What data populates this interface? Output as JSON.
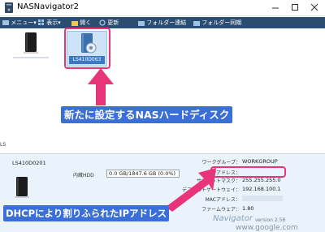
{
  "window": {
    "title": "NASNavigator2"
  },
  "toolbar": {
    "menu": "メニュー",
    "view": "表示",
    "open": "開く",
    "refresh": "更新",
    "folder_link": "フォルダー連結",
    "folder_sync": "フォルダー同期"
  },
  "devices": [
    {
      "label": "",
      "selected": false
    },
    {
      "label": "LS410D063",
      "selected": true
    }
  ],
  "annotations": {
    "new_nas": "新たに設定するNASハードディスク",
    "dhcp_ip": "DHCPにより割りふられたIPアドレス"
  },
  "detail": {
    "device_name": "LS410D0201",
    "hdd_label": "内蔵HDD",
    "hdd_usage": "0.0 GB/1847.6 GB (0.0%)",
    "workgroup_label": "ワークグループ：",
    "workgroup_value": "WORKGROUP",
    "ip_label": "IPアドレス：",
    "ip_value": "",
    "subnet_label": "サブネットマスク：",
    "subnet_value": "255.255.255.0",
    "gateway_label": "デフォルトゲートウェイ：",
    "gateway_value": "192.168.100.1",
    "mac_label": "MACアドレス：",
    "mac_value": "",
    "firmware_label": "ファームウェア：",
    "firmware_value": "1.80",
    "app_name": "Navigator",
    "app_version": "version 2.58",
    "watermark": "www.google.com"
  },
  "colors": {
    "toolbar_bg": "#2b4d72",
    "highlight": "#e8357a",
    "callout_bg": "#3b6fd8",
    "detail_bg": "#eaf3fb"
  }
}
